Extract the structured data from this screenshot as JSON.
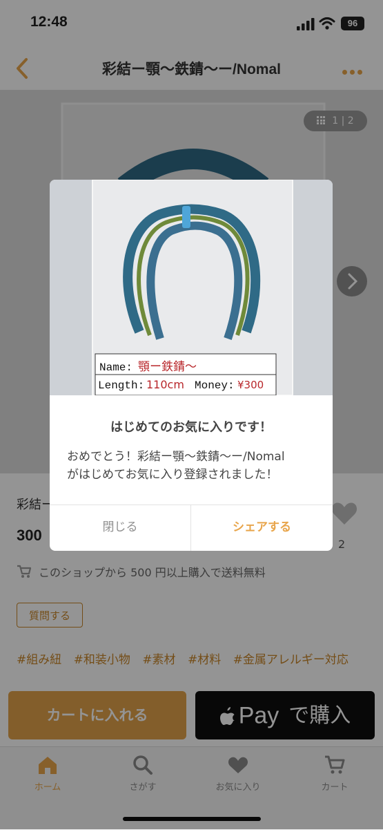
{
  "status_bar": {
    "time": "12:48",
    "battery": "96"
  },
  "header": {
    "title": "彩結ー顎〜鉄錆〜ー/Nomal"
  },
  "gallery": {
    "counter": "1 | 2"
  },
  "product": {
    "title": "彩結ー顎〜鉄錆〜ー/Nomal",
    "price": "300",
    "favorite_count": "2",
    "shipping_note": "このショップから 500 円以上購入で送料無料",
    "ask_label": "質問する",
    "tags": [
      "#組み紐",
      "#和装小物",
      "#素材",
      "#材料",
      "#金属アレルギー対応"
    ]
  },
  "buy": {
    "cart_label": "カートに入れる",
    "applepay_pay": "Pay",
    "applepay_buy": "で購入"
  },
  "tabs": [
    {
      "label": "ホーム",
      "icon": "home-icon"
    },
    {
      "label": "さがす",
      "icon": "search-icon"
    },
    {
      "label": "お気に入り",
      "icon": "heart-icon"
    },
    {
      "label": "カート",
      "icon": "cart-icon"
    }
  ],
  "photo_label": {
    "name_key": "Name:",
    "name_val": "顎ー鉄錆〜",
    "length_key": "Length:",
    "length_val": "110cm",
    "money_key": "Money:",
    "money_val": "¥300"
  },
  "dialog": {
    "title": "はじめてのお気に入りです！",
    "message_line1": "おめでとう！彩結ー顎〜鉄錆〜ー/Nomal",
    "message_line2": "がはじめてお気に入り登録されました！",
    "close_label": "閉じる",
    "share_label": "シェアする"
  },
  "colors": {
    "accent": "#e8a54b",
    "cord_blue": "#2f6a86",
    "cord_green": "#6f8a3a",
    "label_red": "#b8262a"
  }
}
